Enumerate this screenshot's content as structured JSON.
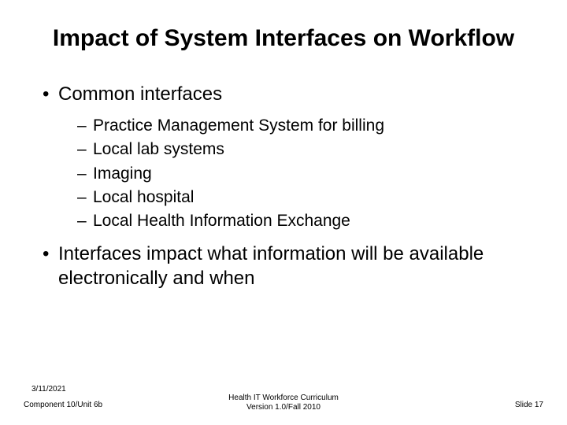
{
  "title": "Impact of System Interfaces on Workflow",
  "bullets": [
    {
      "text": "Common interfaces",
      "children": [
        "Practice Management System for billing",
        "Local lab systems",
        "Imaging",
        "Local hospital",
        "Local Health Information Exchange"
      ]
    },
    {
      "text": "Interfaces impact what information will be available electronically and when",
      "children": []
    }
  ],
  "footer": {
    "date": "3/11/2021",
    "left": "Component 10/Unit 6b",
    "center_line1": "Health IT Workforce Curriculum",
    "center_line2": "Version 1.0/Fall 2010",
    "right": "Slide 17"
  }
}
